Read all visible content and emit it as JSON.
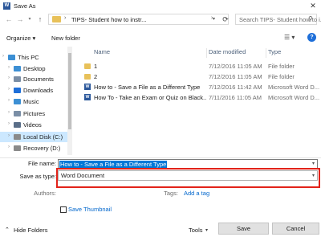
{
  "window": {
    "title": "Save As",
    "app_icon_letter": "W",
    "close_glyph": "✕"
  },
  "address": {
    "path": "TIPS- Student how to instr...",
    "search_placeholder": "Search TIPS- Student how to i..."
  },
  "toolbar": {
    "organize_label": "Organize ▾",
    "new_folder_label": "New folder"
  },
  "nav_pane": {
    "items": [
      {
        "label": "This PC",
        "icon": "computer-icon",
        "color": "#3c8fd4"
      },
      {
        "label": "Desktop",
        "icon": "desktop-icon",
        "color": "#3c8fd4"
      },
      {
        "label": "Documents",
        "icon": "documents-icon",
        "color": "#7a8ea6"
      },
      {
        "label": "Downloads",
        "icon": "downloads-icon",
        "color": "#1e6fd9"
      },
      {
        "label": "Music",
        "icon": "music-icon",
        "color": "#3c8fd4"
      },
      {
        "label": "Pictures",
        "icon": "pictures-icon",
        "color": "#7a8ea6"
      },
      {
        "label": "Videos",
        "icon": "videos-icon",
        "color": "#5a6e88"
      },
      {
        "label": "Local Disk (C:)",
        "icon": "drive-icon",
        "color": "#8a8a8a"
      },
      {
        "label": "Recovery (D:)",
        "icon": "drive-icon",
        "color": "#8a8a8a"
      }
    ],
    "selected": "Local Disk (C:)"
  },
  "file_list": {
    "columns": [
      "Name",
      "Date modified",
      "Type"
    ],
    "rows": [
      {
        "name": "1",
        "date": "7/12/2016 11:05 AM",
        "type": "File folder",
        "icon": "folder-icon"
      },
      {
        "name": "2",
        "date": "7/12/2016 11:05 AM",
        "type": "File folder",
        "icon": "folder-icon"
      },
      {
        "name": "How to - Save a File as a Different Type",
        "date": "7/12/2016 11:42 AM",
        "type": "Microsoft Word D...",
        "icon": "word-document-icon"
      },
      {
        "name": "How To - Take an Exam or Quiz on Black...",
        "date": "7/11/2016 11:05 AM",
        "type": "Microsoft Word D...",
        "icon": "word-document-icon"
      }
    ]
  },
  "form": {
    "filename_label": "File name:",
    "filename_value": "How to - Save a File as a Different Type",
    "saveas_label": "Save as type:",
    "saveas_value": "Word Document",
    "authors_label": "Authors:",
    "authors_value": "",
    "tags_label": "Tags:",
    "tags_value": "Add a tag",
    "thumbnail_label": "Save Thumbnail",
    "highlight_color": "#e2231a"
  },
  "footer": {
    "hide_folders_label": "Hide Folders",
    "tools_label": "Tools",
    "save_label": "Save",
    "cancel_label": "Cancel"
  }
}
